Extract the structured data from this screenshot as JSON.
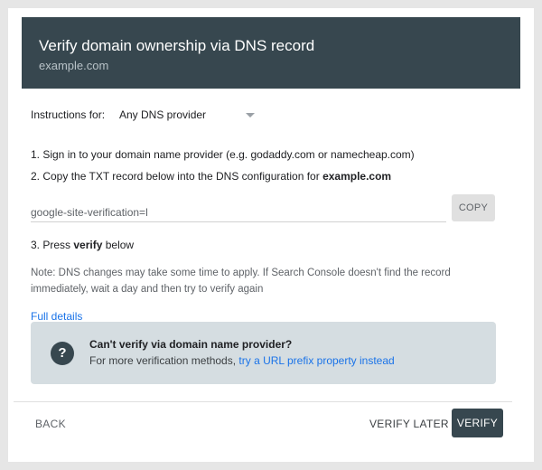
{
  "header": {
    "title": "Verify domain ownership via DNS record",
    "subtitle": "example.com"
  },
  "instructions": {
    "label": "Instructions for:",
    "selected": "Any DNS provider"
  },
  "steps": {
    "step1": "1. Sign in to your domain name provider (e.g. godaddy.com or namecheap.com)",
    "step2_prefix": "2. Copy the TXT record below into the DNS configuration for ",
    "step2_domain": "example.com",
    "step3_prefix": "3. Press ",
    "step3_bold": "verify",
    "step3_suffix": " below"
  },
  "txt_record": {
    "value": "google-site-verification=l"
  },
  "copy_button": "COPY",
  "note": "Note: DNS changes may take some time to apply. If Search Console doesn't find the record immediately, wait a day and then try to verify again",
  "full_details_link": "Full details",
  "help_box": {
    "icon": "?",
    "title": "Can't verify via domain name provider?",
    "text_prefix": "For more verification methods, ",
    "link": "try a URL prefix property instead"
  },
  "footer": {
    "back": "BACK",
    "verify_later": "VERIFY LATER",
    "verify": "VERIFY"
  },
  "colors": {
    "header_bg": "#37474f",
    "link": "#1a73e8",
    "help_bg": "#d5dde1"
  }
}
